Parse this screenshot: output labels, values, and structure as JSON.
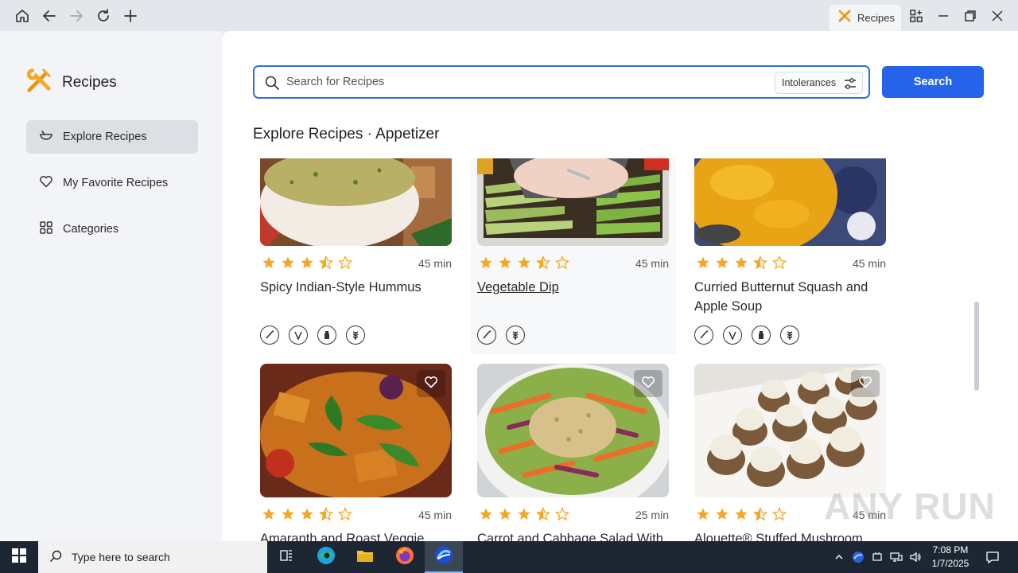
{
  "browser": {
    "tab_label": "Recipes"
  },
  "sidebar": {
    "brand_title": "Recipes",
    "items": [
      {
        "label": "Explore Recipes",
        "active": true
      },
      {
        "label": "My Favorite Recipes",
        "active": false
      },
      {
        "label": "Categories",
        "active": false
      }
    ]
  },
  "search": {
    "placeholder": "Search for Recipes",
    "intolerances_label": "Intolerances",
    "button_label": "Search"
  },
  "section_title": "Explore Recipes · Appetizer",
  "recipes": [
    {
      "title": "Spicy Indian-Style Hummus",
      "time": "45 min",
      "rating": 3.5,
      "diet_icons": [
        "vegan-icon",
        "vegetarian-icon",
        "dairy-free-icon",
        "gluten-free-icon"
      ]
    },
    {
      "title": "Vegetable Dip",
      "time": "45 min",
      "rating": 3.5,
      "diet_icons": [
        "vegan-icon",
        "gluten-free-icon"
      ]
    },
    {
      "title": "Curried Butternut Squash and Apple Soup",
      "time": "45 min",
      "rating": 3.5,
      "diet_icons": [
        "vegan-icon",
        "vegetarian-icon",
        "dairy-free-icon",
        "gluten-free-icon"
      ]
    },
    {
      "title": "Amaranth and Roast Veggie",
      "time": "45 min",
      "rating": 3.5
    },
    {
      "title": "Carrot and Cabbage Salad With",
      "time": "25 min",
      "rating": 3.5
    },
    {
      "title": "Alouette® Stuffed Mushroom",
      "time": "45 min",
      "rating": 3.5
    }
  ],
  "taskbar": {
    "search_placeholder": "Type here to search",
    "time": "7:08 PM",
    "date": "1/7/2025"
  },
  "watermark": "ANY RUN",
  "colors": {
    "accent": "#2563eb",
    "star": "#f5a623",
    "sidebar_bg": "#f2f4f7"
  }
}
